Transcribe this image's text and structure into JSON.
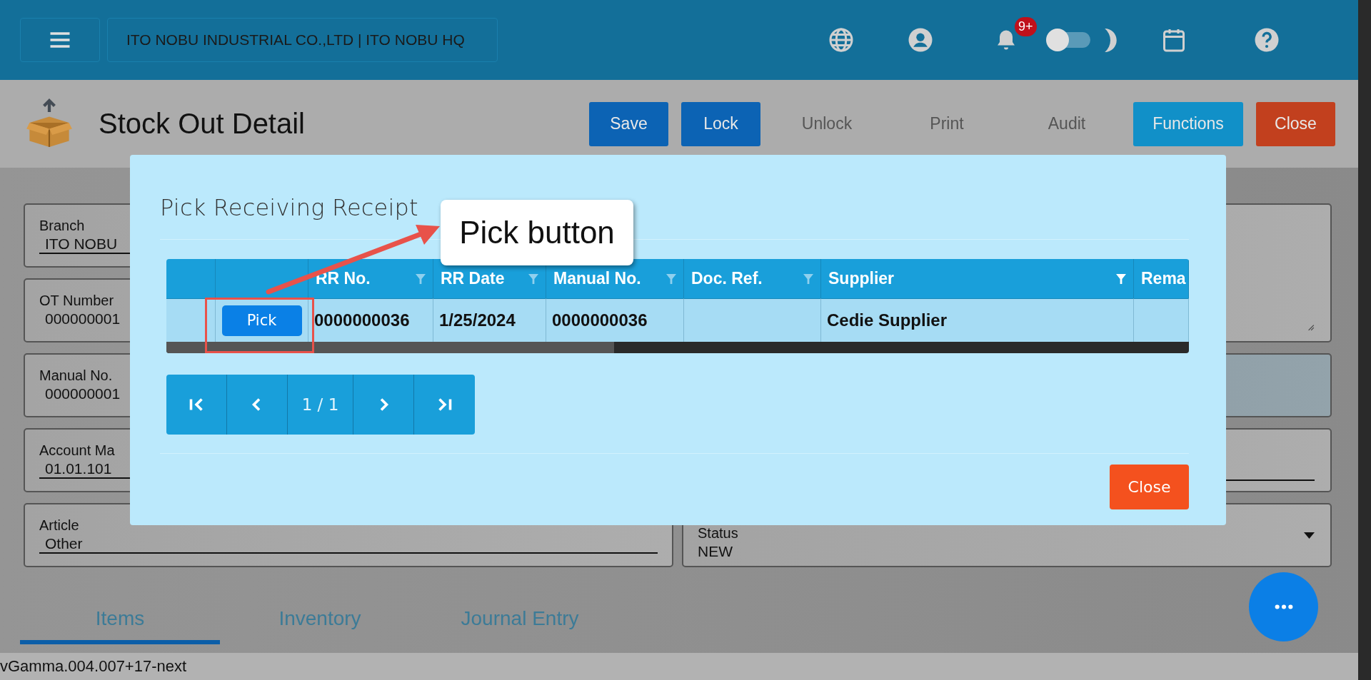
{
  "topbar": {
    "company": "ITO NOBU INDUSTRIAL CO.,LTD | ITO NOBU HQ",
    "notification_badge": "9+",
    "dark_mode": false
  },
  "page": {
    "title": "Stock Out Detail",
    "buttons": [
      {
        "label": "Save",
        "kind": "primary"
      },
      {
        "label": "Lock",
        "kind": "primary"
      },
      {
        "label": "Unlock",
        "kind": "disabled"
      },
      {
        "label": "Print",
        "kind": "disabled"
      },
      {
        "label": "Audit",
        "kind": "disabled"
      },
      {
        "label": "Functions",
        "kind": "info"
      },
      {
        "label": "Close",
        "kind": "danger"
      }
    ]
  },
  "form": {
    "left": [
      {
        "kind": "input",
        "label": "Branch",
        "value": "ITO NOBU"
      },
      {
        "kind": "readonly",
        "label": "OT Number",
        "value": "000000001"
      },
      {
        "kind": "readonly",
        "label": "Manual No.",
        "value": "000000001"
      },
      {
        "kind": "input",
        "label": "Account Ma",
        "value": "01.01.101"
      },
      {
        "kind": "input",
        "label": "Article",
        "value": "Other"
      }
    ],
    "right": [
      {
        "kind": "textarea"
      },
      {
        "kind": "readonly"
      },
      {
        "kind": "input"
      },
      {
        "kind": "select",
        "label": "Status",
        "value": "NEW"
      }
    ]
  },
  "tabs": [
    {
      "label": "Items",
      "selected": true
    },
    {
      "label": "Inventory",
      "selected": false
    },
    {
      "label": "Journal Entry",
      "selected": false
    }
  ],
  "version": "vGamma.004.007+17-next",
  "dialog": {
    "title": "Pick Receiving Receipt",
    "columns": [
      {
        "label": "RR No.",
        "filter_active": false
      },
      {
        "label": "RR Date",
        "filter_active": false
      },
      {
        "label": "Manual No.",
        "filter_active": false
      },
      {
        "label": "Doc. Ref.",
        "filter_active": false
      },
      {
        "label": "Supplier",
        "filter_active": true
      },
      {
        "label": "Rema"
      }
    ],
    "rows": [
      {
        "action": "Pick",
        "cells": [
          "0000000036",
          "1/25/2024",
          "0000000036",
          null,
          "Cedie Supplier",
          null
        ]
      }
    ],
    "pager": {
      "label": "1 / 1"
    },
    "close": "Close"
  },
  "annotation": {
    "label": "Pick button"
  }
}
